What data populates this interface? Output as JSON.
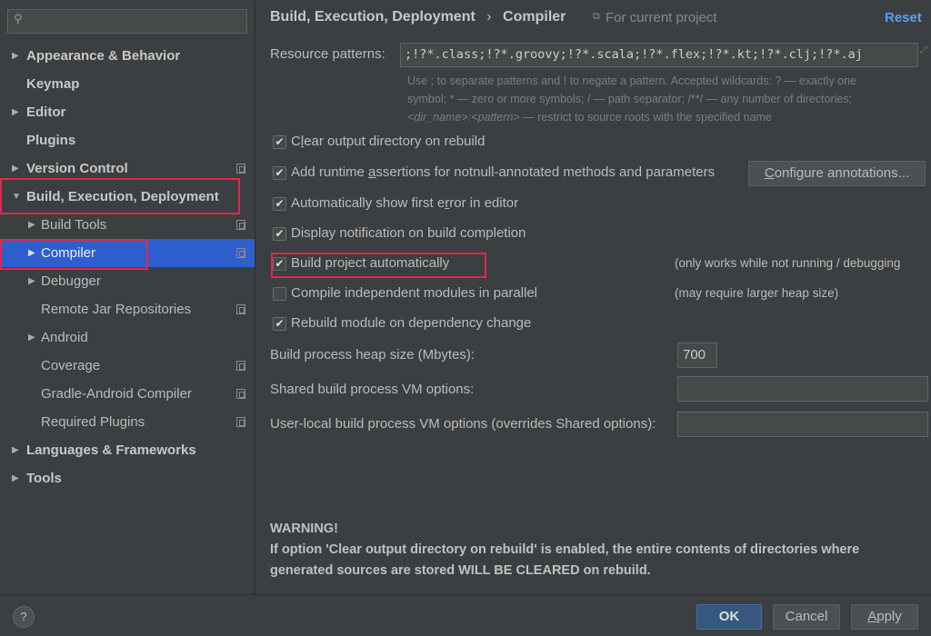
{
  "sidebar": {
    "search_placeholder": "",
    "items": [
      {
        "label": "Appearance & Behavior",
        "level": 0,
        "arrow": "right",
        "bold": true,
        "copy": false
      },
      {
        "label": "Keymap",
        "level": 0,
        "arrow": "",
        "bold": true,
        "copy": false
      },
      {
        "label": "Editor",
        "level": 0,
        "arrow": "right",
        "bold": true,
        "copy": false
      },
      {
        "label": "Plugins",
        "level": 0,
        "arrow": "",
        "bold": true,
        "copy": false
      },
      {
        "label": "Version Control",
        "level": 0,
        "arrow": "right",
        "bold": true,
        "copy": true
      },
      {
        "label": "Build, Execution, Deployment",
        "level": 0,
        "arrow": "down",
        "bold": true,
        "copy": false
      },
      {
        "label": "Build Tools",
        "level": 1,
        "arrow": "right",
        "bold": false,
        "copy": true
      },
      {
        "label": "Compiler",
        "level": 1,
        "arrow": "right",
        "bold": false,
        "copy": true,
        "selected": true
      },
      {
        "label": "Debugger",
        "level": 1,
        "arrow": "right",
        "bold": false,
        "copy": false
      },
      {
        "label": "Remote Jar Repositories",
        "level": 1,
        "arrow": "",
        "bold": false,
        "copy": true
      },
      {
        "label": "Android",
        "level": 1,
        "arrow": "right",
        "bold": false,
        "copy": false
      },
      {
        "label": "Coverage",
        "level": 1,
        "arrow": "",
        "bold": false,
        "copy": true
      },
      {
        "label": "Gradle-Android Compiler",
        "level": 1,
        "arrow": "",
        "bold": false,
        "copy": true
      },
      {
        "label": "Required Plugins",
        "level": 1,
        "arrow": "",
        "bold": false,
        "copy": true
      },
      {
        "label": "Languages & Frameworks",
        "level": 0,
        "arrow": "right",
        "bold": true,
        "copy": false
      },
      {
        "label": "Tools",
        "level": 0,
        "arrow": "right",
        "bold": true,
        "copy": false
      }
    ]
  },
  "header": {
    "breadcrumb_parent": "Build, Execution, Deployment",
    "separator": "›",
    "breadcrumb_current": "Compiler",
    "scope": "For current project",
    "reset": "Reset"
  },
  "resource": {
    "label": "Resource patterns:",
    "value": ";!?*.class;!?*.groovy;!?*.scala;!?*.flex;!?*.kt;!?*.clj;!?*.aj",
    "help1": "Use ; to separate patterns and ! to negate a pattern. Accepted wildcards: ? — exactly one",
    "help2": "symbol; * — zero or more symbols; / — path separator; /**/ — any number of directories;",
    "help3_italic": "<dir_name>:<pattern>",
    "help3": " — restrict to source roots with the specified name"
  },
  "checkboxes": [
    {
      "label": "Clear output directory on rebuild",
      "checked": true,
      "underline": 1
    },
    {
      "label": "Add runtime assertions for notnull-annotated methods and parameters",
      "checked": true,
      "underline": 12
    },
    {
      "label": "Automatically show first error in editor",
      "checked": true,
      "underline": 26
    },
    {
      "label": "Display notification on build completion",
      "checked": true,
      "underline": -1
    },
    {
      "label": "Build project automatically",
      "checked": true,
      "underline": -1,
      "note": "(only works while not running / debugging"
    },
    {
      "label": "Compile independent modules in parallel",
      "checked": false,
      "underline": -1,
      "note": "(may require larger heap size)"
    },
    {
      "label": "Rebuild module on dependency change",
      "checked": true,
      "underline": -1
    }
  ],
  "configure_annotations": "Configure annotations...",
  "options": {
    "heap_label": "Build process heap size (Mbytes):",
    "heap_value": "700",
    "shared_label": "Shared build process VM options:",
    "shared_value": "",
    "user_label": "User-local build process VM options (overrides Shared options):",
    "user_value": ""
  },
  "warning": {
    "title": "WARNING!",
    "line1": "If option 'Clear output directory on rebuild' is enabled, the entire contents of directories where",
    "line2": "generated sources are stored WILL BE CLEARED on rebuild."
  },
  "footer": {
    "help": "?",
    "ok": "OK",
    "cancel": "Cancel",
    "apply": "Apply"
  },
  "colors": {
    "selection": "#2f5fce",
    "highlight": "#e0284b",
    "link": "#589df6",
    "ok_button": "#365880"
  }
}
